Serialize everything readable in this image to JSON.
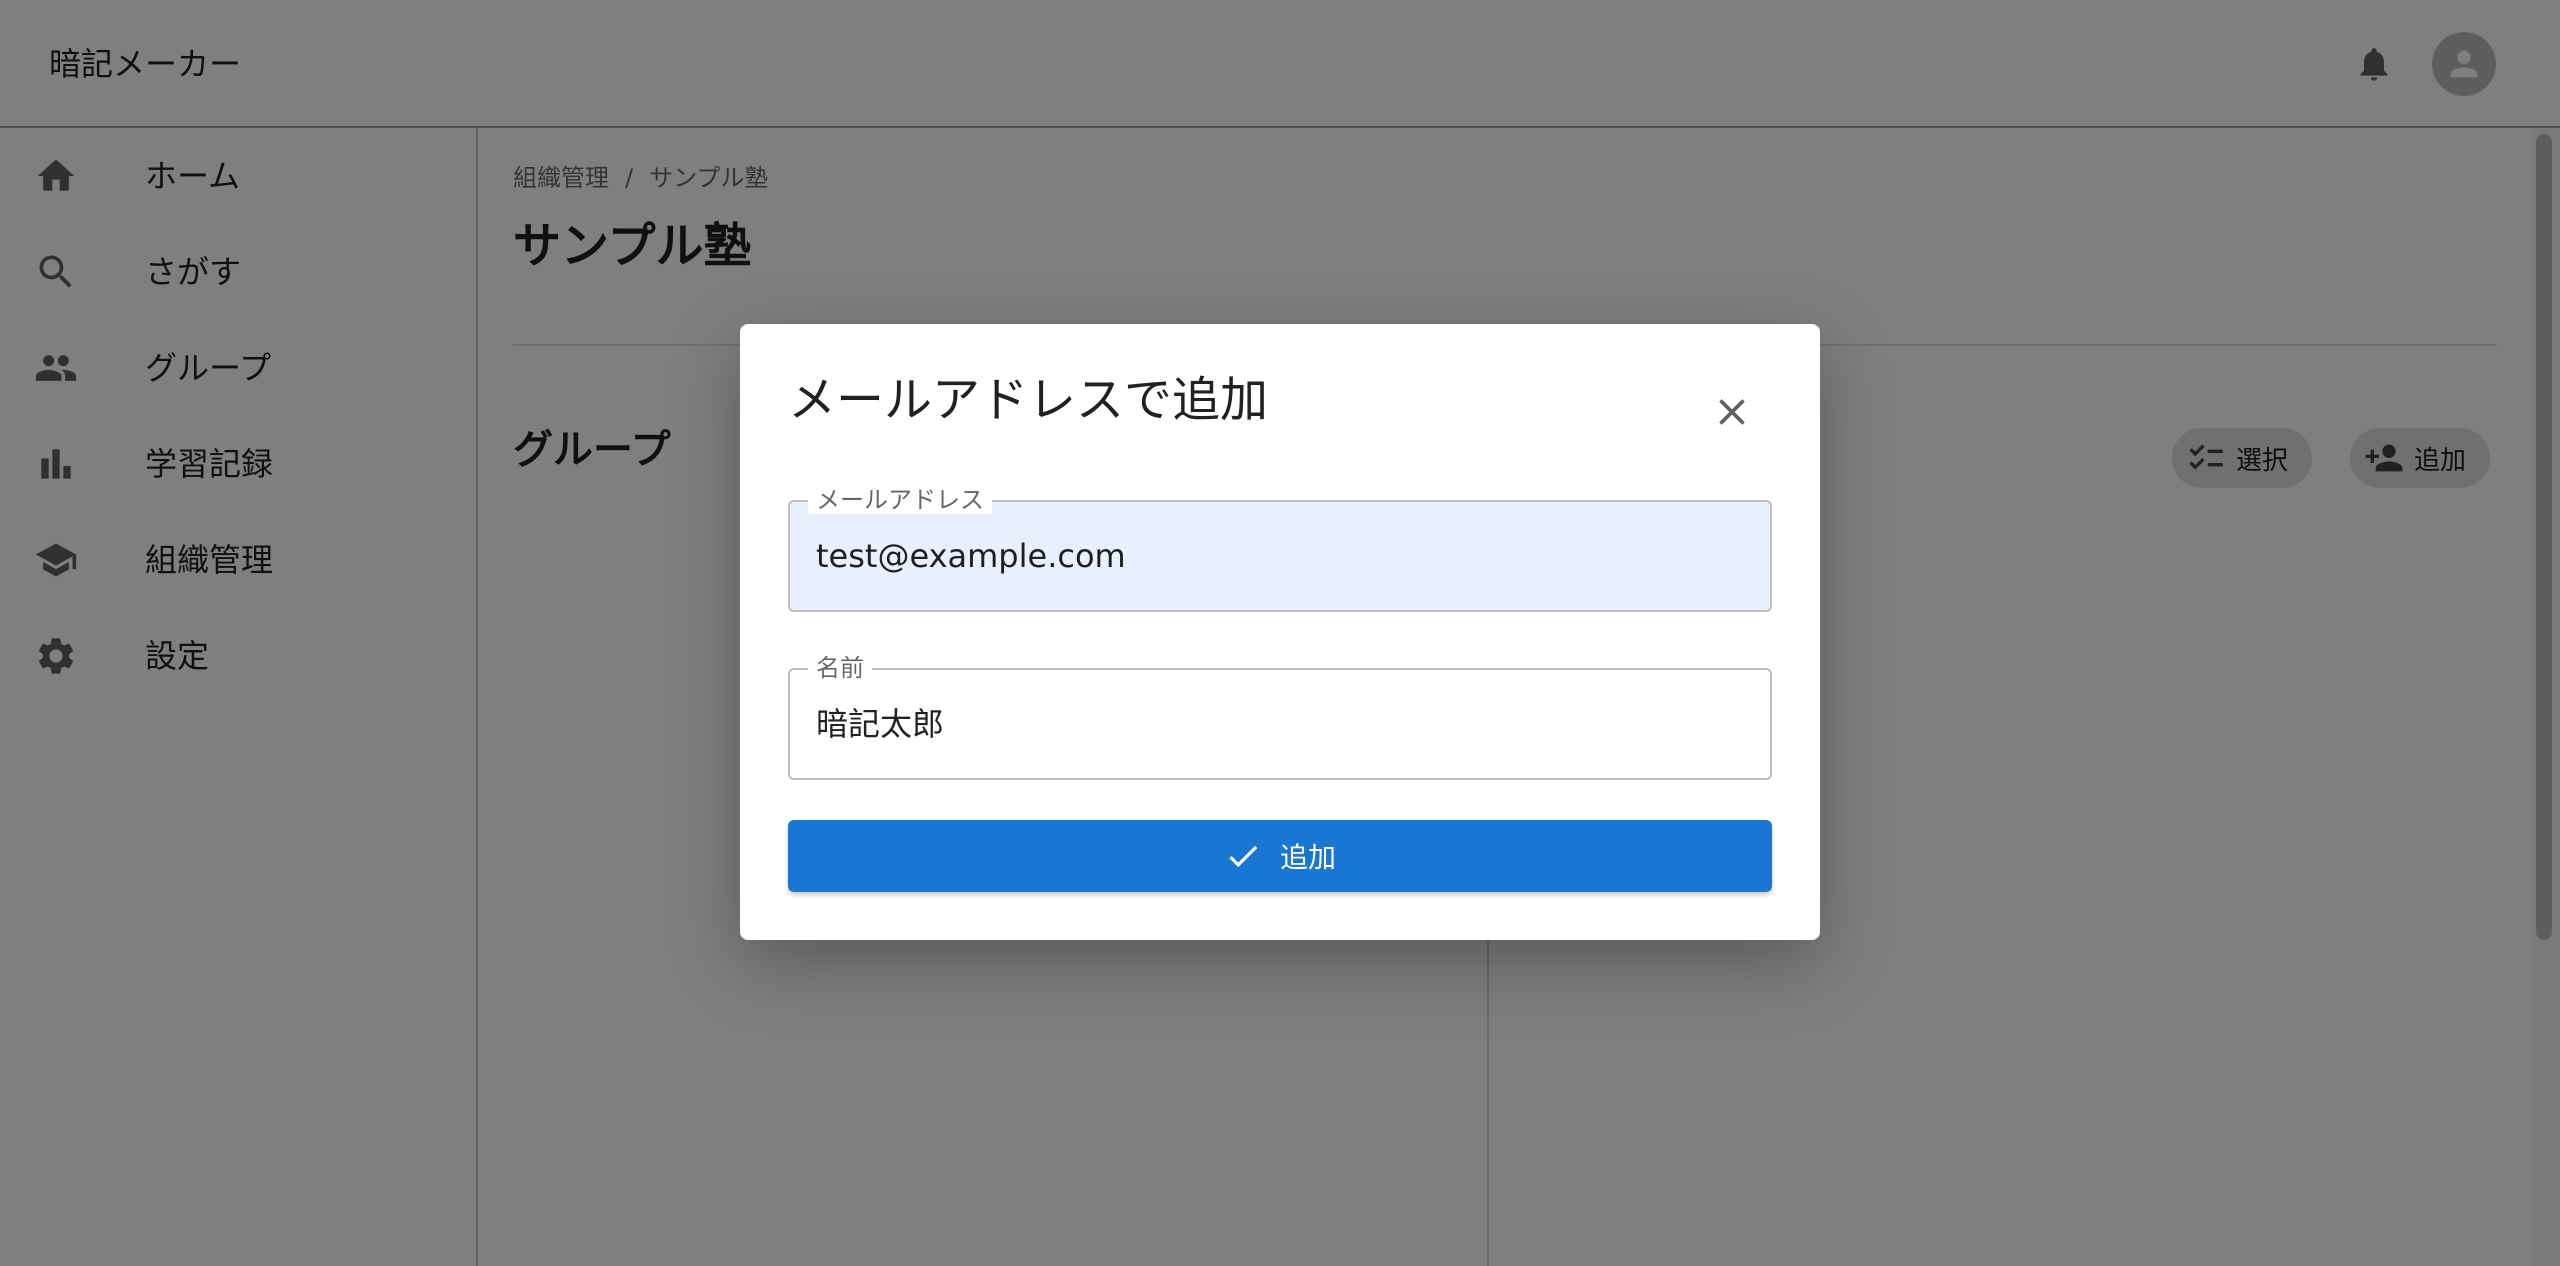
{
  "app": {
    "title": "暗記メーカー"
  },
  "header": {
    "icons": [
      "bell-icon",
      "account-icon"
    ]
  },
  "sidebar": {
    "items": [
      {
        "label": "ホーム",
        "icon": "home-icon"
      },
      {
        "label": "さがす",
        "icon": "search-icon"
      },
      {
        "label": "グループ",
        "icon": "people-icon"
      },
      {
        "label": "学習記録",
        "icon": "bar-chart-icon"
      },
      {
        "label": "組織管理",
        "icon": "school-icon"
      },
      {
        "label": "設定",
        "icon": "gear-icon"
      }
    ]
  },
  "main": {
    "breadcrumb": {
      "parent": "組織管理",
      "separator": "/",
      "current": "サンプル塾"
    },
    "title": "サンプル塾",
    "section": {
      "title": "グループ",
      "select_label": "選択",
      "add_label": "追加"
    }
  },
  "dialog": {
    "title": "メールアドレスで追加",
    "email": {
      "label": "メールアドレス",
      "value": "test@example.com"
    },
    "name": {
      "label": "名前",
      "value": "暗記太郎"
    },
    "submit_label": "追加"
  },
  "colors": {
    "primary": "#1976d2",
    "autofill": "#e8f0fe",
    "backdrop": "rgba(0,0,0,0.5)"
  }
}
